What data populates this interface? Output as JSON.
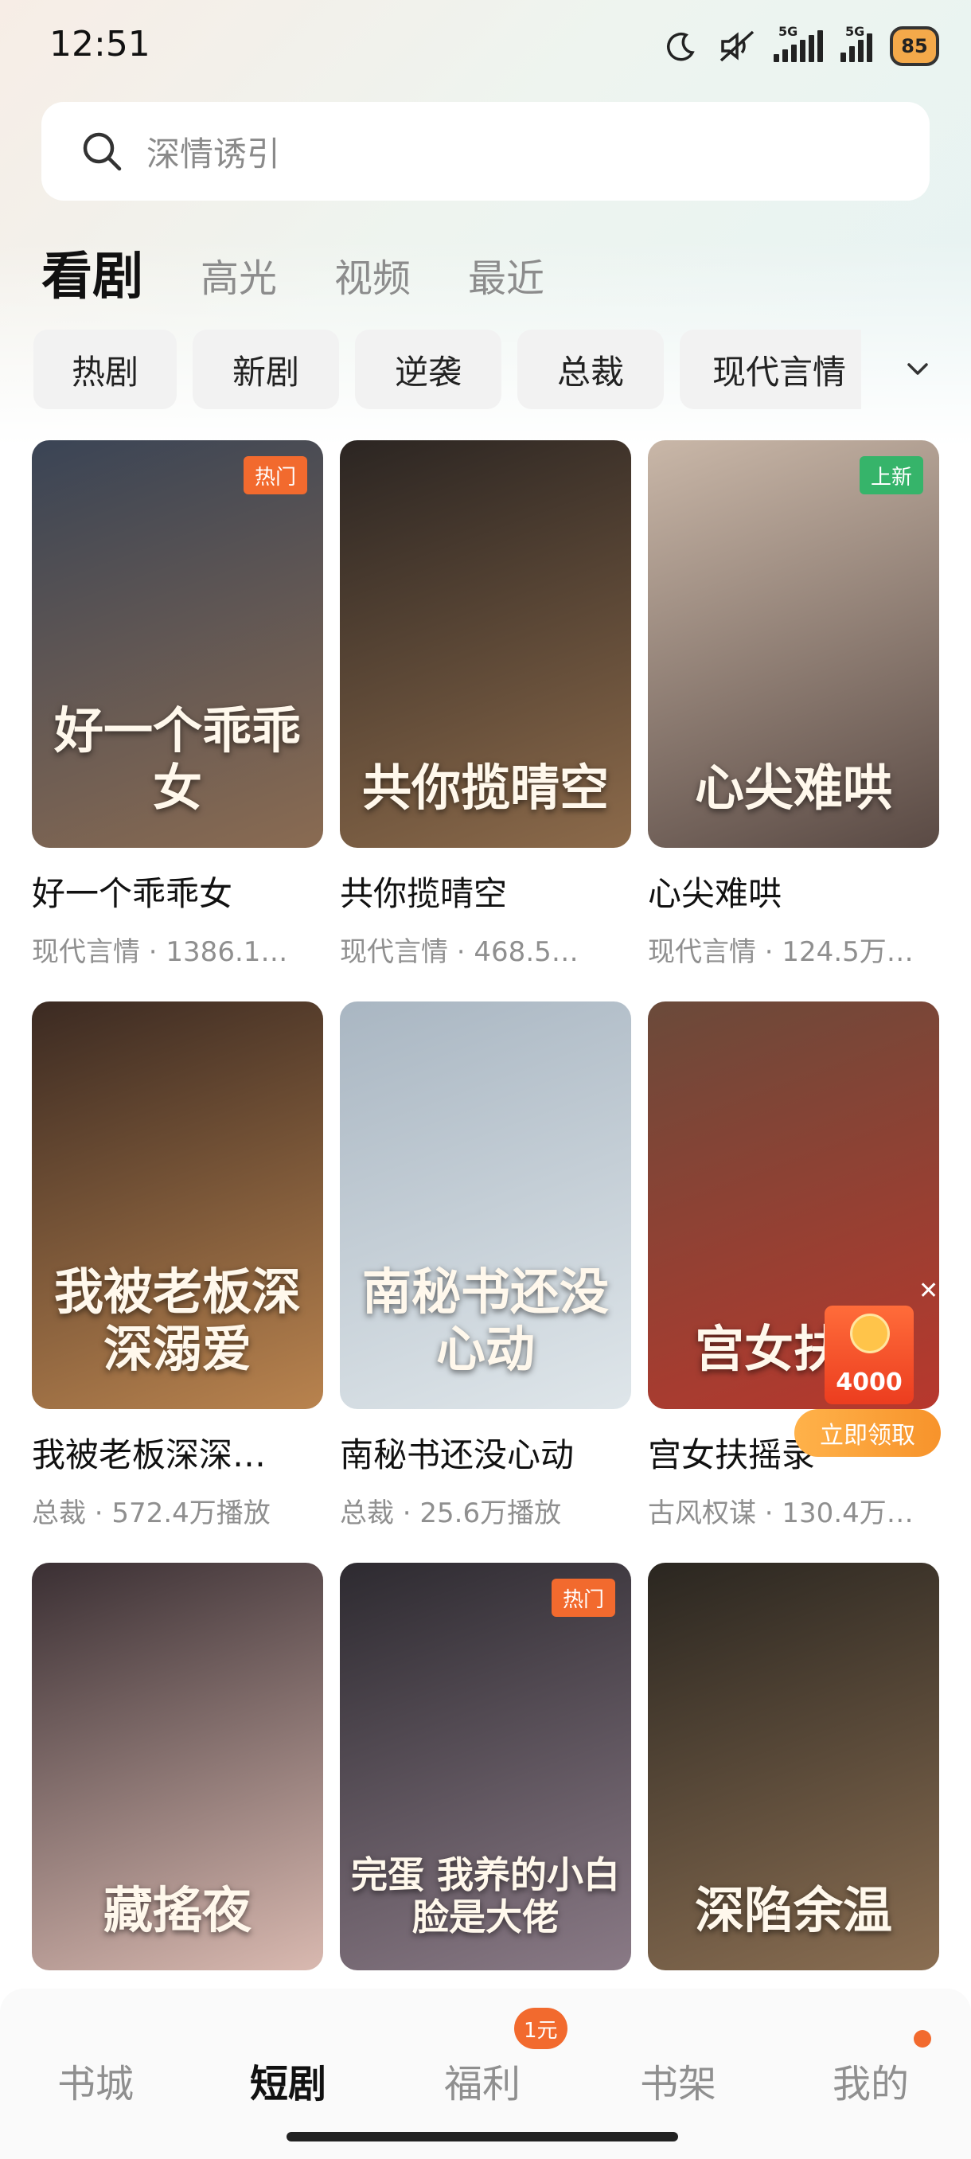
{
  "status_bar": {
    "time": "12:51",
    "battery": "85",
    "network_tags": [
      "5G",
      "5G"
    ],
    "icons": [
      "moon-icon",
      "mute-icon",
      "signal-icon",
      "signal-icon",
      "battery-icon"
    ]
  },
  "search": {
    "placeholder": "深情诱引"
  },
  "tabs": [
    {
      "label": "看剧",
      "active": true
    },
    {
      "label": "高光",
      "active": false
    },
    {
      "label": "视频",
      "active": false
    },
    {
      "label": "最近",
      "active": false
    }
  ],
  "chips": [
    "热剧",
    "新剧",
    "逆袭",
    "总裁",
    "现代言情"
  ],
  "cards": [
    {
      "title": "好一个乖乖女",
      "meta": "现代言情 · 1386.1…",
      "poster_text": "好一个乖乖女",
      "badge": "热门",
      "badge_type": "hot",
      "colors": [
        "#3a4455",
        "#8a6b52"
      ]
    },
    {
      "title": "共你揽晴空",
      "meta": "现代言情 · 468.5…",
      "poster_text": "共你揽晴空",
      "badge": "",
      "badge_type": "",
      "colors": [
        "#2b2522",
        "#8c6a4a"
      ]
    },
    {
      "title": "心尖难哄",
      "meta": "现代言情 · 124.5万…",
      "poster_text": "心尖难哄",
      "badge": "上新",
      "badge_type": "new",
      "colors": [
        "#c9b7a8",
        "#5a4a44"
      ]
    },
    {
      "title": "我被老板深深…",
      "meta": "总裁 · 572.4万播放",
      "poster_text": "我被老板深深溺爱",
      "badge": "",
      "badge_type": "",
      "colors": [
        "#3b2a22",
        "#b9834e"
      ]
    },
    {
      "title": "南秘书还没心动",
      "meta": "总裁 · 25.6万播放",
      "poster_text": "南秘书还没心动",
      "badge": "",
      "badge_type": "",
      "colors": [
        "#a9b6c2",
        "#dfe6ea"
      ]
    },
    {
      "title": "宫女扶摇录",
      "meta": "古风权谋 · 130.4万…",
      "poster_text": "宫女扶摇",
      "badge": "",
      "badge_type": "",
      "colors": [
        "#6a4a3a",
        "#b8382d"
      ]
    },
    {
      "title": "",
      "meta": "",
      "poster_text": "藏搖夜",
      "badge": "",
      "badge_type": "",
      "colors": [
        "#3a2f33",
        "#d9b9b0"
      ]
    },
    {
      "title": "",
      "meta": "",
      "poster_text": "完蛋 我养的小白脸是大佬",
      "badge": "热门",
      "badge_type": "hot",
      "colors": [
        "#2d2a30",
        "#8a7a86"
      ]
    },
    {
      "title": "",
      "meta": "",
      "poster_text": "深陷余温",
      "badge": "",
      "badge_type": "",
      "colors": [
        "#2a2620",
        "#8a6e52"
      ]
    }
  ],
  "reward": {
    "amount": "4000",
    "button": "立即领取"
  },
  "bottom_nav": [
    {
      "label": "书城",
      "active": false
    },
    {
      "label": "短剧",
      "active": true
    },
    {
      "label": "福利",
      "active": false,
      "badge": "1元"
    },
    {
      "label": "书架",
      "active": false
    },
    {
      "label": "我的",
      "active": false,
      "dot": true
    }
  ]
}
